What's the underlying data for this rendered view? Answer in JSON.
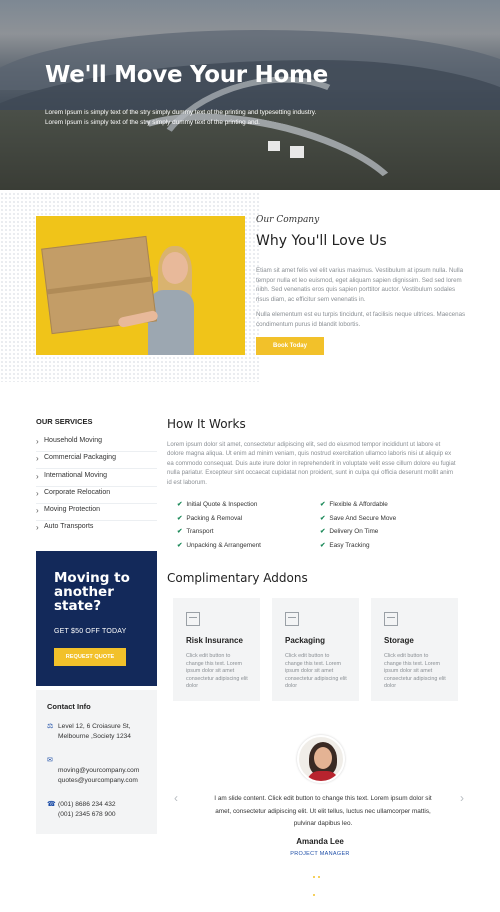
{
  "hero": {
    "title": "We'll Move Your Home",
    "subtitle": "Lorem Ipsum is simply text of the stry simply dummy text of the printing and typesetting industry. Lorem Ipsum is simply text of the stry simply dummy text of the printing and."
  },
  "about": {
    "eyebrow": "Our Company",
    "title": "Why You'll Love Us",
    "paragraph1": "Etiam sit amet felis vel elit varius maximus. Vestibulum at ipsum nulla. Nulla tempor nulla et leo euismod, eget aliquam sapien dignissim. Sed sed lorem nibh. Sed venenatis eros quis sapien porttitor auctor. Vestibulum sodales risus diam, ac efficitur sem venenatis in.",
    "paragraph2": "Nulla elementum est eu turpis tincidunt, et facilisis neque ultrices. Maecenas condimentum purus id blandit lobortis.",
    "button": "Book Today"
  },
  "sidebar": {
    "services_title": "OUR SERVICES",
    "services": [
      "Household Moving",
      "Commercial Packaging",
      "International Moving",
      "Corporate Relocation",
      "Moving Protection",
      "Auto Transports"
    ],
    "promo": {
      "title": "Moving to another state?",
      "offer": "GET $50 OFF TODAY",
      "button": "REQUEST QUOTE"
    },
    "contact": {
      "title": "Contact Info",
      "address_line1": "Level 12, 6 Croiasure St,",
      "address_line2": "Melbourne ,Society 1234",
      "email1": "moving@yourcompany.com",
      "email2": "quotes@yourcompany.com",
      "phone1": "(001) 8686 234 432",
      "phone2": "(001) 2345 678 900"
    }
  },
  "how_it_works": {
    "title": "How It Works",
    "text": "Lorem ipsum dolor sit amet, consectetur adipiscing elit, sed do eiusmod tempor incididunt ut labore et dolore magna aliqua. Ut enim ad minim veniam, quis nostrud exercitation ullamco laboris nisi ut aliquip ex ea commodo consequat. Duis aute irure dolor in reprehenderit in voluptate velit esse cillum dolore eu fugiat nulla pariatur. Excepteur sint occaecat cupidatat non proident, sunt in culpa qui officia deserunt mollit anim id est laborum.",
    "features_left": [
      "Initial Quote & Inspection",
      "Packing & Removal",
      "Transport",
      "Unpacking & Arrangement"
    ],
    "features_right": [
      "Flexible & Affordable",
      "Save And Secure Move",
      "Delivery On Time",
      "Easy Tracking"
    ]
  },
  "addons": {
    "title": "Complimentary Addons",
    "cards": [
      {
        "title": "Risk Insurance",
        "text": "Click edit button to change this text. Lorem ipsum dolor sit amet consectetur adipiscing elit dolor",
        "icon": "house-icon"
      },
      {
        "title": "Packaging",
        "text": "Click edit button to change this text. Lorem ipsum dolor sit amet consectetur adipiscing elit dolor",
        "icon": "box-icon"
      },
      {
        "title": "Storage",
        "text": "Click edit button to change this text. Lorem ipsum dolor sit amet consectetur adipiscing elit dolor",
        "icon": "storage-icon"
      }
    ]
  },
  "testimonial": {
    "quote": "I am slide content. Click edit button to change this text. Lorem ipsum dolor sit amet, consectetur adipiscing elit. Ut elit tellus, luctus nec ullamcorper mattis, pulvinar dapibus leo.",
    "name": "Amanda Lee",
    "role": "PROJECT MANAGER",
    "prev": "‹",
    "next": "›"
  },
  "colors": {
    "accent": "#f2c12a",
    "navy": "#13295a",
    "link": "#1f4fa8",
    "check": "#1d8a5a"
  }
}
